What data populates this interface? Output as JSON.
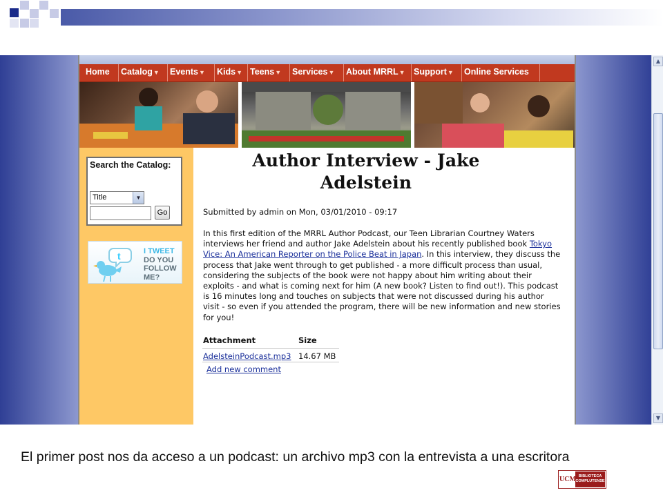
{
  "site": {
    "nav": [
      {
        "label": "Home",
        "dropdown": false
      },
      {
        "label": "Catalog",
        "dropdown": true
      },
      {
        "label": "Events",
        "dropdown": true
      },
      {
        "label": "Kids",
        "dropdown": true
      },
      {
        "label": "Teens",
        "dropdown": true
      },
      {
        "label": "Services",
        "dropdown": true
      },
      {
        "label": "About MRRL",
        "dropdown": true
      },
      {
        "label": "Support",
        "dropdown": true
      },
      {
        "label": "Online Services",
        "dropdown": false
      }
    ],
    "search": {
      "title": "Search the Catalog:",
      "select_value": "Title",
      "go_label": "Go"
    },
    "tweet": {
      "line1": "I TWEET",
      "line2": "DO YOU",
      "line3": "FOLLOW ME?"
    },
    "article": {
      "title": "Author Interview - Jake Adelstein",
      "submitted": "Submitted by admin on Mon, 03/01/2010 - 09:17",
      "body_before": "In this first edition of the MRRL Author Podcast, our Teen Librarian Courtney Waters interviews her friend and author Jake Adelstein about his recently published book ",
      "book_link": "Tokyo Vice: An American Reporter on the Police Beat in Japan",
      "body_after": ". In this interview, they discuss the process that Jake went through to get published - a more difficult process than usual, considering the subjects of the book were not happy about him writing about their exploits - and what is coming next for him (A new book? Listen to find out!). This podcast is 16 minutes long and touches on subjects that were not discussed during his author visit - so even if you attended the program, there will be new information and new stories for you!",
      "attachments": {
        "col_attachment": "Attachment",
        "col_size": "Size",
        "file_name": "AdelsteinPodcast.mp3",
        "file_size": "14.67 MB"
      },
      "add_comment": "Add new comment"
    }
  },
  "slide": {
    "caption": "El primer post nos da acceso a un podcast: un archivo mp3 con la entrevista a una escritora",
    "logo_left": "UCM",
    "logo_right_line1": "BIBLIOTECA",
    "logo_right_line2": "COMPLUTENSE"
  },
  "colors": {
    "nav_red": "#c1391f",
    "sidebar_orange": "#fec865",
    "slide_blue": "#2f3f95",
    "link_blue": "#1a2f9a",
    "logo_red": "#9a1b1b"
  }
}
